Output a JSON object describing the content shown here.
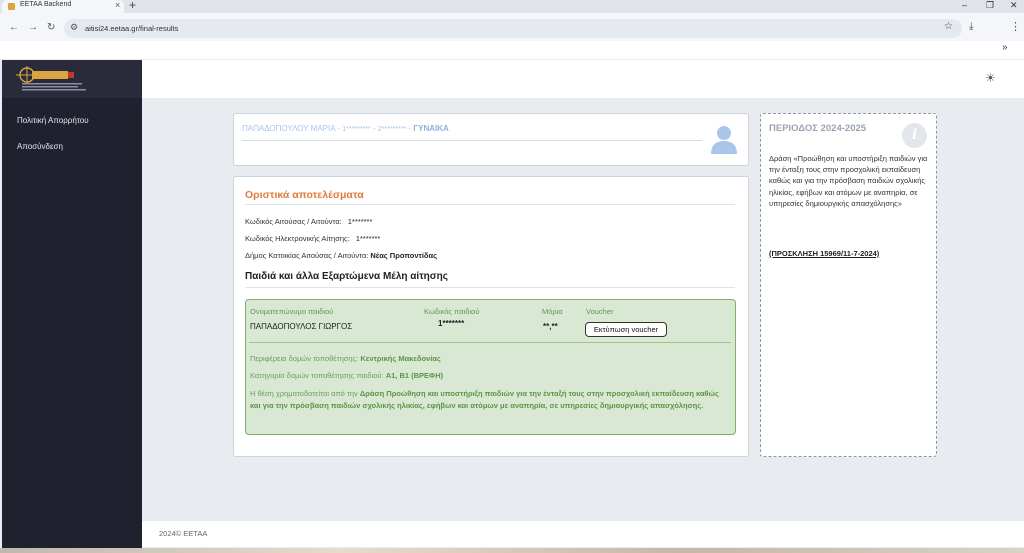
{
  "browser": {
    "tab_title": "EETAA Backend",
    "tab_close": "×",
    "new_tab": "+",
    "url": "aitisi24.eetaa.gr/final-results",
    "controls": {
      "minimize": "–",
      "restore": "❐",
      "close": "✕"
    },
    "nav": {
      "back": "←",
      "forward": "→",
      "reload": "↻"
    }
  },
  "sidebar": {
    "items": [
      {
        "label": "Πολιτική Απορρήτου"
      },
      {
        "label": "Αποσύνδεση"
      }
    ]
  },
  "user": {
    "name": "ΠΑΠΑΔΟΠΟΥΛΟΥ ΜΑΡΙΑ",
    "sep": " - ",
    "id1": "1*********",
    "id2": "2*********",
    "gender": "ΓΥΝΑΙΚΑ"
  },
  "results": {
    "title": "Οριστικά αποτελέσματα",
    "rows": [
      {
        "label": "Κωδικός Αιτούσας / Αιτούντα:",
        "value": "1*******"
      },
      {
        "label": "Κωδικός Ηλεκτρονικής Αίτησης:",
        "value": "1*******"
      },
      {
        "label": "Δήμος Κατοικίας Αιτούσας / Αιτούντα:",
        "value": "Νέας Προποντίδας"
      }
    ],
    "children_title": "Παιδιά και άλλα Εξαρτώμενα Μέλη αίτησης",
    "child": {
      "headers": {
        "name": "Ονοματεπώνυμο παιδιού",
        "code": "Κωδικός παιδιού",
        "points": "Μόρια",
        "voucher": "Voucher"
      },
      "name": "ΠΑΠΑΔΟΠΟΥΛΟΣ ΓΙΩΡΓΟΣ",
      "code": "1*******",
      "points": "**,**",
      "voucher_button": "Εκτύπωση voucher",
      "region_label": "Περιφέρεια δομών τοποθέτησης:",
      "region_value": "Κεντρικής Μακεδονίας",
      "category_label": "Κατηγορία δομών τοποθέτησης παιδιού:",
      "category_value": "Α1, Β1 (ΒΡΕΦΗ)",
      "desc_prefix": "Η θέση χρηματοδοτείται από την",
      "desc_bold": "Δράση Προώθηση και υποστήριξη παιδιών για την ένταξή τους στην προσχολική εκπαίδευση καθώς και για την πρόσβαση παιδιών σχολικής ηλικίας, εφήβων και ατόμων με αναπηρία, σε υπηρεσίες δημιουργικής απασχόλησης."
    }
  },
  "info": {
    "title": "ΠΕΡΙΟΔΟΣ 2024-2025",
    "description": "Δράση «Προώθηση και υποστήριξη παιδιών για την ένταξη τους στην προσχολική εκπαίδευση καθώς και για την πρόσβαση παιδιών σχολικής ηλικίας, εφήβων και ατόμων με αναπηρία, σε υπηρεσίες δημιουργικής απασχόλησης»",
    "link": "(ΠΡΟΣΚΛΗΣΗ 15969/11-7-2024)"
  },
  "footer": {
    "text": "2024© ΕΕΤΑΑ"
  },
  "colors": {
    "sidebar": "#20212e",
    "accent_orange": "#e07b39",
    "success_bg": "#d8e8d2",
    "success_text": "#6aa05b",
    "user_text": "#a9c4e6"
  },
  "icons": [
    "sun-icon",
    "info-icon",
    "user-avatar-icon",
    "star-icon",
    "download-icon",
    "menu-dots-icon"
  ]
}
